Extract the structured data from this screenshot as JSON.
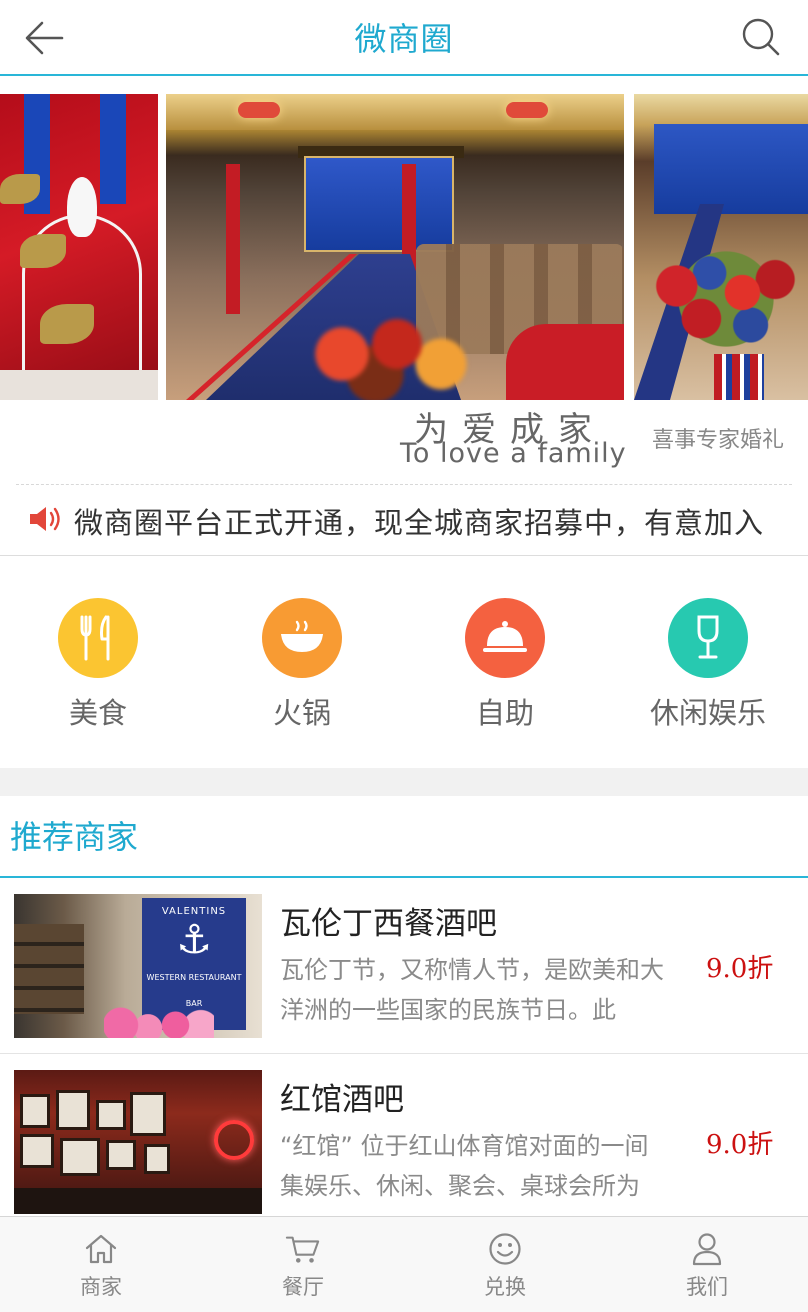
{
  "header": {
    "title": "微商圈"
  },
  "banner": {
    "slogan_cn": "为爱成家",
    "slogan_en": "To love a family",
    "slogan_side": "喜事专家婚礼"
  },
  "notice": {
    "text": "微商圈平台正式开通，现全城商家招募中，有意加入"
  },
  "categories": [
    {
      "label": "美食",
      "icon": "fork-knife-icon",
      "color": "#fbc531"
    },
    {
      "label": "火锅",
      "icon": "hotpot-icon",
      "color": "#f89b33"
    },
    {
      "label": "自助",
      "icon": "cloche-icon",
      "color": "#f46140"
    },
    {
      "label": "休闲娱乐",
      "icon": "wine-glass-icon",
      "color": "#27c9b0"
    }
  ],
  "recommend": {
    "title": "推荐商家",
    "items": [
      {
        "name": "瓦伦丁西餐酒吧",
        "desc": "瓦伦丁节，又称情人节，是欧美和大洋洲的一些国家的民族节日。此",
        "discount": "9.0折",
        "thumb_poster_title": "VALENTINS",
        "thumb_poster_sub": "WESTERN RESTAURANT",
        "thumb_poster_bar": "BAR"
      },
      {
        "name": "红馆酒吧",
        "desc": "“红馆” 位于红山体育馆对面的一间集娱乐、休闲、聚会、桌球会所为",
        "discount": "9.0折"
      }
    ]
  },
  "bottom_nav": [
    {
      "label": "商家",
      "icon": "home-icon"
    },
    {
      "label": "餐厅",
      "icon": "cart-icon"
    },
    {
      "label": "兑换",
      "icon": "smiley-icon"
    },
    {
      "label": "我们",
      "icon": "user-icon"
    }
  ],
  "colors": {
    "accent": "#1fa9cf",
    "discount": "#cc1111"
  }
}
